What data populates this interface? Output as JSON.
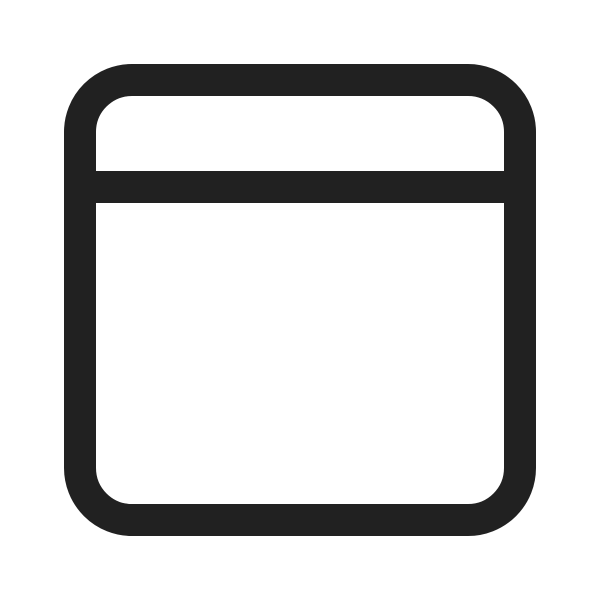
{
  "icon": {
    "name": "window-icon",
    "stroke_color": "#212121",
    "background_color": "#ffffff"
  }
}
